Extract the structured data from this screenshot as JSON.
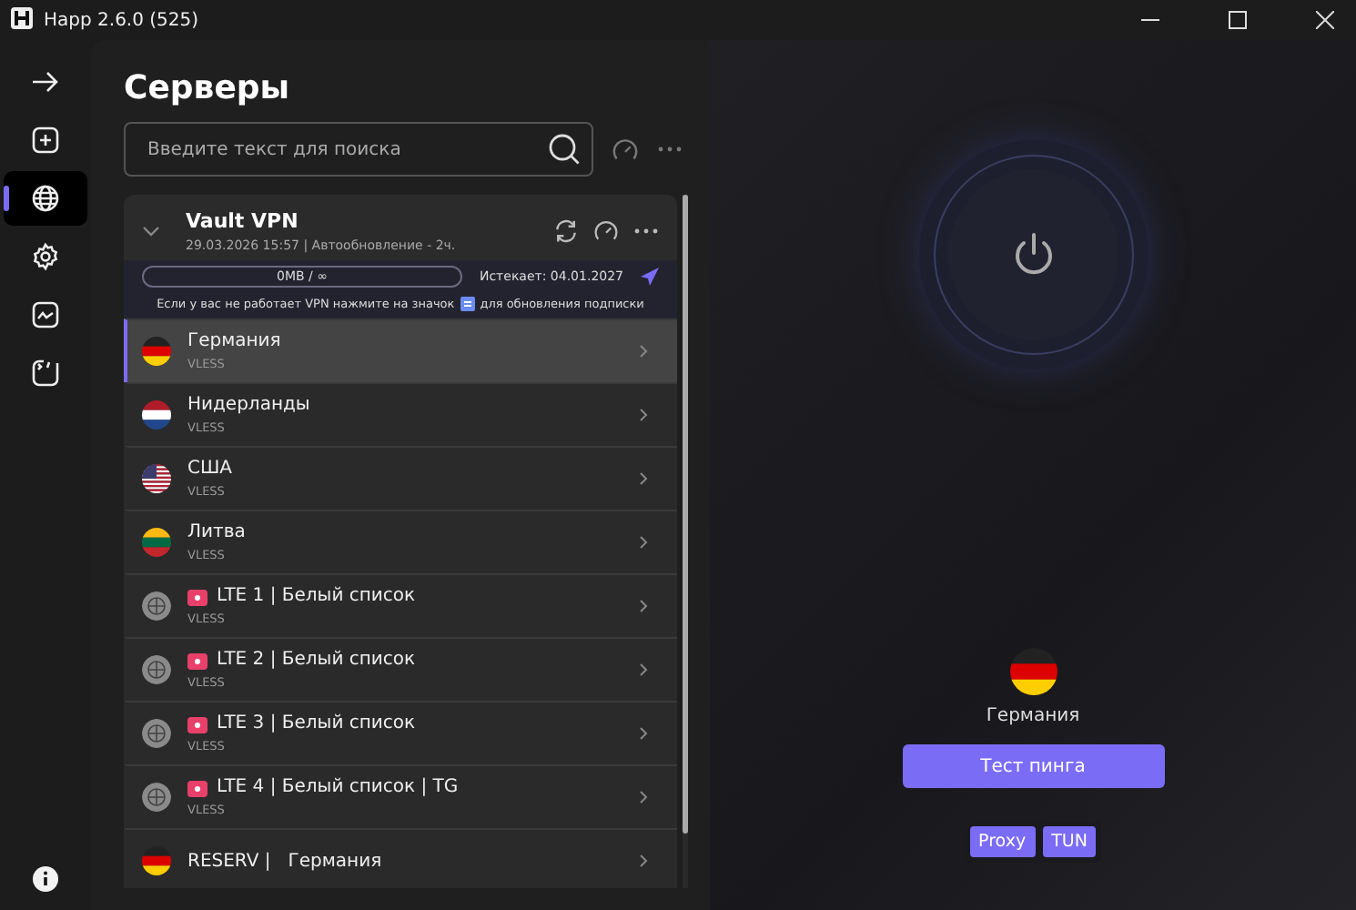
{
  "window": {
    "title": "Happ 2.6.0 (525)"
  },
  "sidebar": {
    "items": [
      {
        "kind": "arrow",
        "selected": false
      },
      {
        "kind": "add",
        "selected": false
      },
      {
        "kind": "globe",
        "selected": true
      },
      {
        "kind": "gear",
        "selected": false
      },
      {
        "kind": "chart",
        "selected": false
      },
      {
        "kind": "import",
        "selected": false
      }
    ]
  },
  "servers": {
    "title": "Серверы",
    "search": {
      "placeholder": "Введите текст для поиска"
    },
    "group": {
      "name": "Vault VPN",
      "expanded": true,
      "updated": "29.03.2026 15:57 | Автообновление - 2ч.",
      "traffic": "0MB / ∞",
      "expires": "Истекает: 04.01.2027",
      "notice_before": "Если у вас не работает VPN нажмите на значок",
      "notice_after": "для обновления подписки"
    },
    "items": [
      {
        "name": "Германия",
        "protocol": "VLESS",
        "kind": "de",
        "badge": false,
        "selected": true
      },
      {
        "name": "Нидерланды",
        "protocol": "VLESS",
        "kind": "nl",
        "badge": false,
        "selected": false
      },
      {
        "name": "США",
        "protocol": "VLESS",
        "kind": "us",
        "badge": false,
        "selected": false
      },
      {
        "name": "Литва",
        "protocol": "VLESS",
        "kind": "lt",
        "badge": false,
        "selected": false
      },
      {
        "name": "LTE 1 | Белый список",
        "protocol": "VLESS",
        "kind": "globe",
        "badge": true,
        "selected": false
      },
      {
        "name": "LTE 2 | Белый список",
        "protocol": "VLESS",
        "kind": "globe",
        "badge": true,
        "selected": false
      },
      {
        "name": "LTE 3 | Белый список",
        "protocol": "VLESS",
        "kind": "globe",
        "badge": true,
        "selected": false
      },
      {
        "name": "LTE 4 | Белый список | TG",
        "protocol": "VLESS",
        "kind": "globe",
        "badge": true,
        "selected": false
      },
      {
        "name": "RESERV |   Германия",
        "kind": "de",
        "badge": false,
        "selected": false
      }
    ]
  },
  "connection": {
    "country": "Германия",
    "kind": "de",
    "ping_button": "Тест пинга",
    "modes": [
      {
        "label": "Proxy",
        "selected": true
      },
      {
        "label": "TUN",
        "selected": true
      }
    ]
  }
}
